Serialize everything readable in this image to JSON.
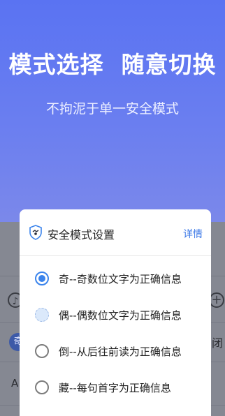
{
  "hero": {
    "headline": "模式选择  随意切换",
    "subline": "不拘泥于单一安全模式"
  },
  "background": {
    "chip_text": "奇",
    "right_text": "闭",
    "left_text": "A",
    "left_icon": "speaker-icon",
    "right_icon": "plus-circle-icon"
  },
  "dialog": {
    "title": "安全模式设置",
    "details_label": "详情",
    "title_icon": "shield-icon",
    "options": [
      {
        "label": "奇--奇数位文字为正确信息",
        "state": "selected"
      },
      {
        "label": "偶--偶数位文字为正确信息",
        "state": "highlighted"
      },
      {
        "label": "倒--从后往前读为正确信息",
        "state": "unselected"
      },
      {
        "label": "藏--每句首字为正确信息",
        "state": "unselected"
      }
    ]
  },
  "colors": {
    "accent": "#3b84ec",
    "link": "#3b78e7",
    "hero_top": "#5a73f2"
  }
}
